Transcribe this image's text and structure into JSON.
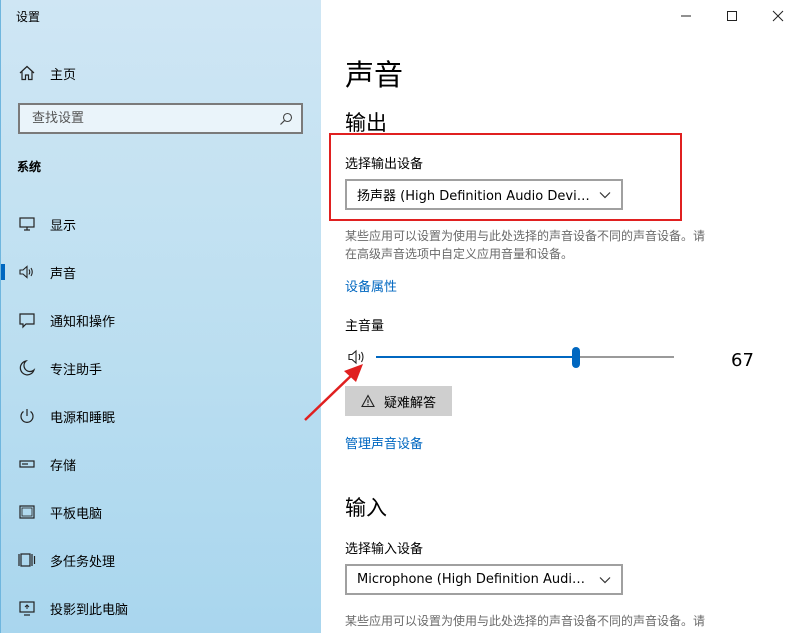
{
  "window": {
    "title": "设置"
  },
  "sidebar": {
    "home_label": "主页",
    "search_placeholder": "查找设置",
    "section_label": "系统",
    "items": [
      {
        "label": "显示",
        "icon": "monitor-icon"
      },
      {
        "label": "声音",
        "icon": "speaker-icon",
        "active": true
      },
      {
        "label": "通知和操作",
        "icon": "notification-icon"
      },
      {
        "label": "专注助手",
        "icon": "moon-icon"
      },
      {
        "label": "电源和睡眠",
        "icon": "power-icon"
      },
      {
        "label": "存储",
        "icon": "storage-icon"
      },
      {
        "label": "平板电脑",
        "icon": "tablet-icon"
      },
      {
        "label": "多任务处理",
        "icon": "multitasking-icon"
      },
      {
        "label": "投影到此电脑",
        "icon": "projection-icon"
      }
    ]
  },
  "main": {
    "page_title": "声音",
    "output": {
      "heading": "输出",
      "device_label": "选择输出设备",
      "device_selected": "扬声器 (High Definition Audio Device)",
      "description_line1": "某些应用可以设置为使用与此处选择的声音设备不同的声音设备。请",
      "description_line2": "在高级声音选项中自定义应用音量和设备。",
      "properties_link": "设备属性",
      "volume_label": "主音量",
      "volume_value": "67",
      "volume_fraction": 0.67,
      "troubleshoot_label": "疑难解答",
      "manage_link": "管理声音设备"
    },
    "input": {
      "heading": "输入",
      "device_label": "选择输入设备",
      "device_selected": "Microphone (High Definition Audio...",
      "description_line1": "某些应用可以设置为使用与此处选择的声音设备不同的声音设备。请"
    }
  },
  "colors": {
    "accent": "#0067c0",
    "annotation": "#e02020",
    "sidebar_bg": "#bfe0f1"
  }
}
